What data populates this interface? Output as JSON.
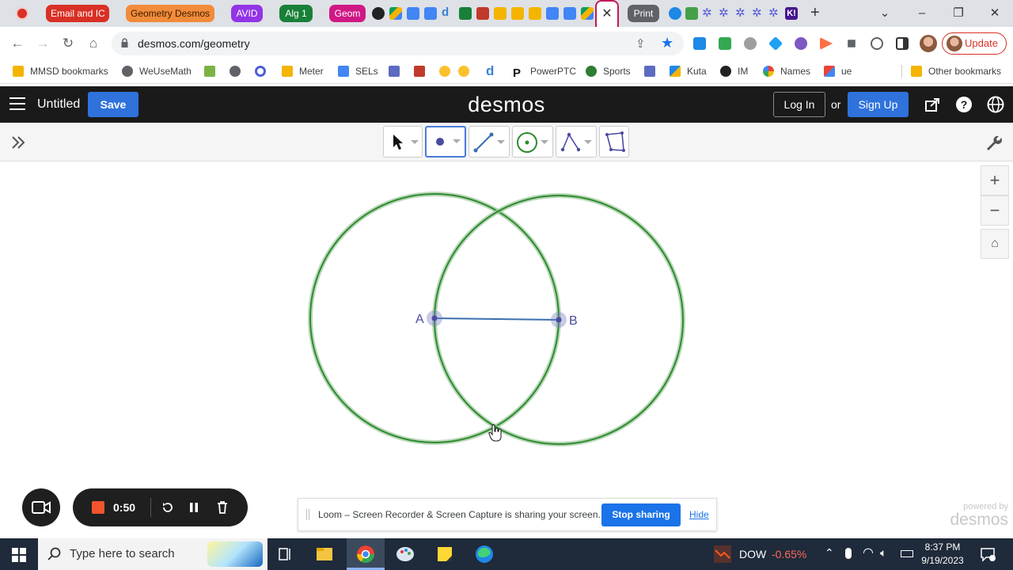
{
  "browser": {
    "tab_groups": [
      {
        "label": "Email and IC",
        "color": "#d93025"
      },
      {
        "label": "Geometry Desmos",
        "color": "#f28b3a"
      },
      {
        "label": "AVID",
        "color": "#9334e6"
      },
      {
        "label": "Alg 1",
        "color": "#188038"
      },
      {
        "label": "Geom",
        "color": "#d01884"
      },
      {
        "label": "Print",
        "color": "#5f6368"
      }
    ],
    "active_tab_close": "✕",
    "new_tab": "+",
    "url": "desmos.com/geometry",
    "update_label": "Update"
  },
  "bookmarks": [
    {
      "label": "MMSD bookmarks",
      "icon": "folder-icon"
    },
    {
      "label": "WeUseMath",
      "icon": "globe-icon"
    },
    {
      "label": "Meter",
      "icon": "slides-icon"
    },
    {
      "label": "SELs",
      "icon": "docs-icon"
    },
    {
      "label": "PowerPTC",
      "icon": "p-icon"
    },
    {
      "label": "Sports",
      "icon": "sports-icon"
    },
    {
      "label": "Kuta",
      "icon": "kuta-icon"
    },
    {
      "label": "IM",
      "icon": "im-icon"
    },
    {
      "label": "Names",
      "icon": "names-icon"
    },
    {
      "label": "ue",
      "icon": "gmail-icon"
    },
    {
      "label": "Other bookmarks",
      "icon": "folder-icon"
    }
  ],
  "desmos": {
    "title": "Untitled",
    "save": "Save",
    "logo": "desmos",
    "login": "Log In",
    "or": "or",
    "signup": "Sign Up"
  },
  "canvas": {
    "point_a": "A",
    "point_b": "B",
    "circle_color": "#2e8b2e",
    "segment_color": "#3a6fb0",
    "point_color": "#7b7bc8"
  },
  "loom": {
    "timer": "0:50",
    "banner_text": "Loom – Screen Recorder & Screen Capture is sharing your screen.",
    "stop_sharing": "Stop sharing",
    "hide": "Hide"
  },
  "watermark": {
    "line1": "powered by",
    "line2": "desmos"
  },
  "taskbar": {
    "search_placeholder": "Type here to search",
    "ticker": "DOW",
    "ticker_change": "-0.65%",
    "time": "8:37 PM",
    "date": "9/19/2023"
  }
}
